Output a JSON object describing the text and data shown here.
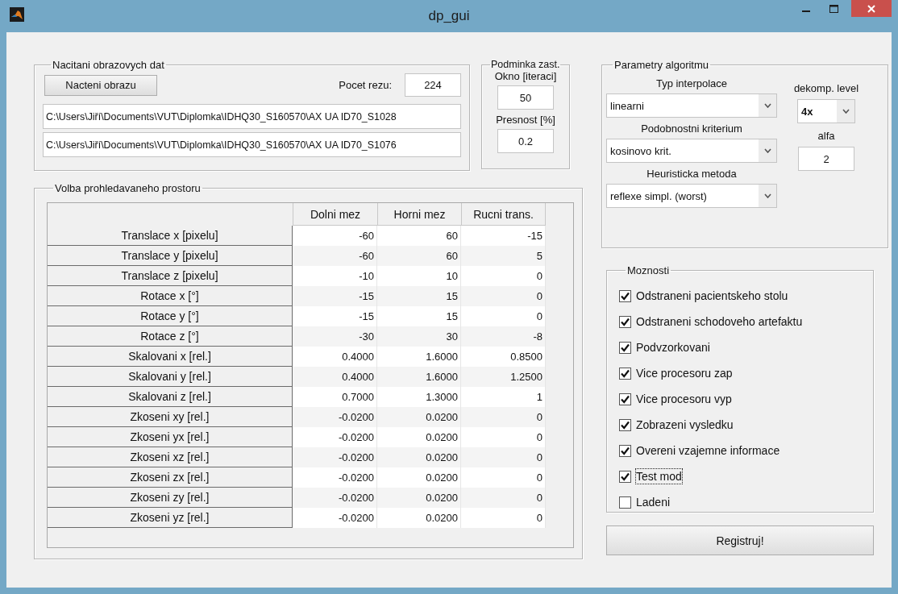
{
  "window": {
    "title": "dp_gui"
  },
  "image_loading": {
    "title": "Nacitani obrazovych dat",
    "load_button": "Nacteni obrazu",
    "slice_count_label": "Pocet rezu:",
    "slice_count": "224",
    "paths": [
      "C:\\Users\\Jiří\\Documents\\VUT\\Diplomka\\IDHQ30_S160570\\AX UA ID70_S1028",
      "C:\\Users\\Jiří\\Documents\\VUT\\Diplomka\\IDHQ30_S160570\\AX UA ID70_S1076"
    ]
  },
  "stop_condition": {
    "title": "Podminka zast.",
    "window_label": "Okno [iteraci]",
    "window_value": "50",
    "precision_label": "Presnost [%]",
    "precision_value": "0.2"
  },
  "search_space": {
    "title": "Volba prohledavaneho prostoru",
    "columns": [
      "Dolni mez",
      "Horni mez",
      "Rucni trans."
    ],
    "rows": [
      {
        "label": "Translace x [pixelu]",
        "cells": [
          "-60",
          "60",
          "-15"
        ]
      },
      {
        "label": "Translace y [pixelu]",
        "cells": [
          "-60",
          "60",
          "5"
        ]
      },
      {
        "label": "Translace z [pixelu]",
        "cells": [
          "-10",
          "10",
          "0"
        ]
      },
      {
        "label": "Rotace x [°]",
        "cells": [
          "-15",
          "15",
          "0"
        ]
      },
      {
        "label": "Rotace y [°]",
        "cells": [
          "-15",
          "15",
          "0"
        ]
      },
      {
        "label": "Rotace z [°]",
        "cells": [
          "-30",
          "30",
          "-8"
        ]
      },
      {
        "label": "Skalovani x [rel.]",
        "cells": [
          "0.4000",
          "1.6000",
          "0.8500"
        ]
      },
      {
        "label": "Skalovani y [rel.]",
        "cells": [
          "0.4000",
          "1.6000",
          "1.2500"
        ]
      },
      {
        "label": "Skalovani z [rel.]",
        "cells": [
          "0.7000",
          "1.3000",
          "1"
        ]
      },
      {
        "label": "Zkoseni xy [rel.]",
        "cells": [
          "-0.0200",
          "0.0200",
          "0"
        ]
      },
      {
        "label": "Zkoseni yx [rel.]",
        "cells": [
          "-0.0200",
          "0.0200",
          "0"
        ]
      },
      {
        "label": "Zkoseni xz [rel.]",
        "cells": [
          "-0.0200",
          "0.0200",
          "0"
        ]
      },
      {
        "label": "Zkoseni zx [rel.]",
        "cells": [
          "-0.0200",
          "0.0200",
          "0"
        ]
      },
      {
        "label": "Zkoseni zy [rel.]",
        "cells": [
          "-0.0200",
          "0.0200",
          "0"
        ]
      },
      {
        "label": "Zkoseni yz [rel.]",
        "cells": [
          "-0.0200",
          "0.0200",
          "0"
        ]
      }
    ]
  },
  "algorithm": {
    "title": "Parametry algoritmu",
    "interpolation_label": "Typ interpolace",
    "interpolation": "linearni",
    "similarity_label": "Podobnostni kriterium",
    "similarity": "kosinovo krit.",
    "heuristic_label": "Heuristicka metoda",
    "heuristic": "reflexe simpl. (worst)",
    "decomposition_label": "dekomp. level",
    "decomposition": "4x",
    "alpha_label": "alfa",
    "alpha": "2"
  },
  "options": {
    "title": "Moznosti",
    "items": [
      {
        "label": "Odstraneni pacientskeho stolu",
        "checked": true,
        "focused": false
      },
      {
        "label": "Odstraneni schodoveho artefaktu",
        "checked": true,
        "focused": false
      },
      {
        "label": "Podvzorkovani",
        "checked": true,
        "focused": false
      },
      {
        "label": "Vice procesoru zap",
        "checked": true,
        "focused": false
      },
      {
        "label": "Vice procesoru vyp",
        "checked": true,
        "focused": false
      },
      {
        "label": "Zobrazeni vysledku",
        "checked": true,
        "focused": false
      },
      {
        "label": "Overeni vzajemne informace",
        "checked": true,
        "focused": false
      },
      {
        "label": "Test mod",
        "checked": true,
        "focused": true
      },
      {
        "label": "Ladeni",
        "checked": false,
        "focused": false
      }
    ]
  },
  "register_button": "Registruj!"
}
